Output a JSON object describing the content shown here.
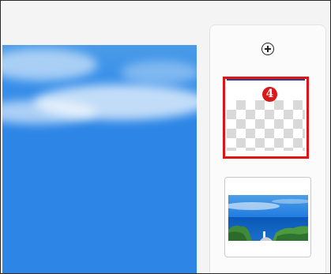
{
  "panel": {
    "add_icon": "plus-circle-icon",
    "selected_slide": {
      "badge_number": "4",
      "state": "selected",
      "highlight_color": "#e01414"
    },
    "slides": [
      {
        "thumbnail": "transparent-checkerboard"
      },
      {
        "thumbnail": "coastal-landscape-photo"
      }
    ]
  },
  "canvas": {
    "background": "sky-photo",
    "sky_color": "#2d86e6"
  }
}
